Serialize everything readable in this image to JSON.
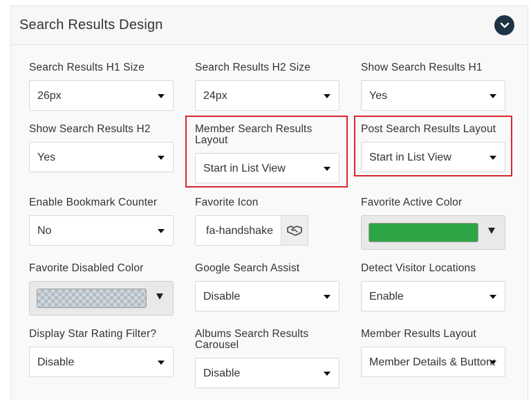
{
  "panel": {
    "title": "Search Results Design",
    "collapse_icon": "chevron-down-icon",
    "accent": "#1f3347"
  },
  "fields": {
    "h1_size": {
      "label": "Search Results H1 Size",
      "value": "26px"
    },
    "h2_size": {
      "label": "Search Results H2 Size",
      "value": "24px"
    },
    "show_h1": {
      "label": "Show Search Results H1",
      "value": "Yes"
    },
    "show_h2": {
      "label": "Show Search Results H2",
      "value": "Yes"
    },
    "member_layout": {
      "label_line1": "Member Search Results",
      "label_line2": "Layout",
      "value": "Start in List View"
    },
    "post_layout": {
      "label": "Post Search Results Layout",
      "value": "Start in List View"
    },
    "bookmark_counter": {
      "label": "Enable Bookmark Counter",
      "value": "No"
    },
    "favorite_icon": {
      "label": "Favorite Icon",
      "value": "fa-handshake",
      "addon_icon": "handshake-icon"
    },
    "favorite_active_color": {
      "label": "Favorite Active Color",
      "color": "#2ea544"
    },
    "favorite_disabled_color": {
      "label": "Favorite Disabled Color",
      "color": "transparent"
    },
    "search_assist": {
      "label": "Google Search Assist",
      "value": "Disable"
    },
    "visitor_locations": {
      "label": "Detect Visitor Locations",
      "value": "Enable"
    },
    "star_rating": {
      "label": "Display Star Rating Filter?",
      "value": "Disable"
    },
    "albums_carousel": {
      "label_line1": "Albums Search Results",
      "label_line2": "Carousel",
      "value": "Disable"
    },
    "member_results_layout": {
      "label": "Member Results Layout",
      "value": "Member Details & Buttons"
    }
  },
  "highlight_color": "#d9272e"
}
